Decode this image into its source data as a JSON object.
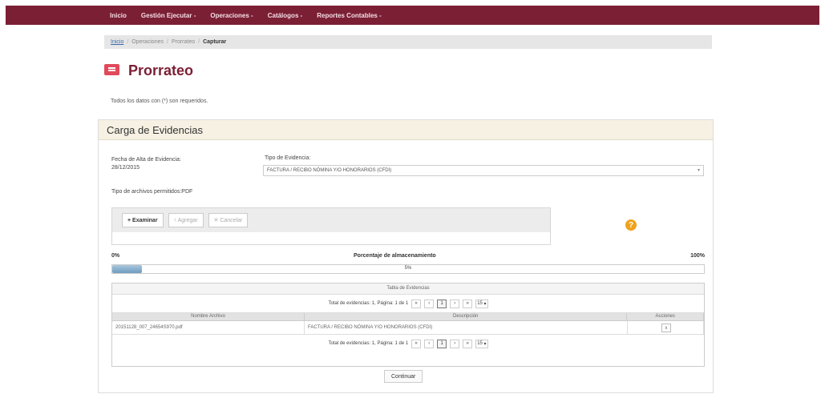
{
  "nav": {
    "items": [
      {
        "label": "Inicio"
      },
      {
        "label": "Gestión Ejecutar -"
      },
      {
        "label": "Operaciones -"
      },
      {
        "label": "Catálogos -"
      },
      {
        "label": "Reportes Contables -"
      }
    ]
  },
  "breadcrumb": {
    "items": [
      "Inicio",
      "Operaciones",
      "Prorrateo"
    ],
    "current": "Capturar"
  },
  "page": {
    "title": "Prorrateo",
    "required_note": "Todos los datos con (*) son requeridos."
  },
  "panel": {
    "title": "Carga de Evidencias",
    "fecha_label": "Fecha de Alta de Evidencia:",
    "fecha_value": "28/12/2015",
    "tipo_label": "Tipo de Evidencia:",
    "tipo_value": "FACTURA / RECIBO NÓMINA Y/O HONORARIOS (CFDI)",
    "tipos_archivo": "Tipo de archivos permitidos:PDF",
    "uploader": {
      "examinar": "+ Examinar",
      "agregar": "↑ Agregar",
      "cancelar": "✕ Cancelar"
    },
    "help_icon": "?",
    "percent": {
      "left": "0%",
      "label": "Porcentaje de almacenamiento",
      "right": "100%",
      "value_text": "5%",
      "value": 0.05
    },
    "table": {
      "caption": "Tabla de Evidencias",
      "pager_text": "Total de evidencias: 1, Página: 1 de 1",
      "pager_page": "1",
      "pager_size": "15",
      "headers": [
        "Nombre Archivo",
        "Descripción",
        "Acciones"
      ],
      "rows": [
        {
          "file": "20151128_007_24654S970.pdf",
          "desc": "FACTURA / RECIBO NÓMINA Y/O HONORARIOS (CFDI)",
          "action": "x"
        }
      ]
    },
    "continuar": "Continuar"
  }
}
